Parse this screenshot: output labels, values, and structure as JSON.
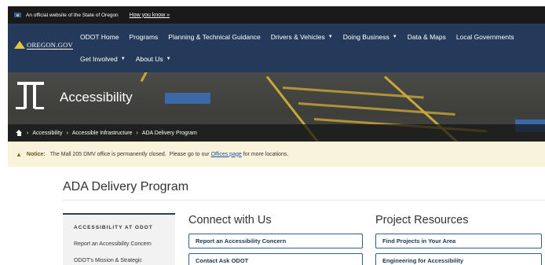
{
  "gov_banner": {
    "text": "An official website of the State of Oregon",
    "link": "How you know »"
  },
  "nav": {
    "logo": "OREGON.GOV",
    "row1": [
      "ODOT Home",
      "Programs",
      "Planning & Technical Guidance",
      "Drivers & Vehicles",
      "Doing Business",
      "Data & Maps",
      "Local Governments"
    ],
    "row2": [
      "Get Involved",
      "About Us"
    ]
  },
  "hero": {
    "title": "Accessibility"
  },
  "breadcrumb": [
    "Accessibility",
    "Accessible Infrastructure",
    "ADA Delivery Program"
  ],
  "notice": {
    "label": "Notice:",
    "text_before": "The Mall 205 DMV office is permanently closed.  Please go to our ",
    "link": "Offices page",
    "text_after": " for more locations."
  },
  "page": {
    "title": "ADA Delivery Program"
  },
  "sidebar": {
    "heading": "ACCESSIBILITY AT ODOT",
    "items": [
      "Report an Accessibility Concern",
      "ODOT's Mission & Strategic"
    ]
  },
  "connect": {
    "heading": "Connect with Us",
    "buttons": [
      "Report an Accessibility Concern",
      "Contact Ask ODOT"
    ]
  },
  "resources": {
    "heading": "Project Resources",
    "buttons": [
      "Find Projects in Your Area",
      "Engineering for Accessibility"
    ]
  }
}
